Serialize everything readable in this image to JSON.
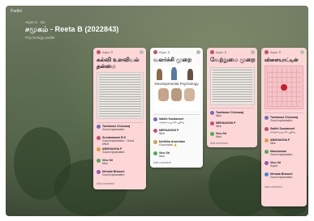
{
  "app": {
    "top_label": "Padlet"
  },
  "header": {
    "crumb": "Arjun S · 2w",
    "title": "சமூகம் - Reeta B (2022843)",
    "subtitle": "Psychology padlet"
  },
  "columns": [
    {
      "author": "Arjun S",
      "title": "கல்வி உளவியல் தன்மை",
      "comments": [
        {
          "name": "Tamilarasi Chinnaraj",
          "text": "Good explanation",
          "color": "#6e6ec8"
        },
        {
          "name": "Sundaramani B D",
          "text": "Good explanation · Good effort",
          "color": "#c8506e"
        },
        {
          "name": "ABISHAGHA P",
          "text": "Good explanation",
          "color": "#d8a23c"
        },
        {
          "name": "Vinu Sri",
          "text": "Nice",
          "color": "#4caf50"
        },
        {
          "name": "Nirmala Bhavani",
          "text": "Good explanation",
          "color": "#8c5ab4"
        }
      ],
      "footer": "Add comment"
    },
    {
      "author": "Arjun S",
      "title": "வளர்ச்சி முறை",
      "image_caption": "Developmental Psychology",
      "comments": [
        {
          "name": "Sakthi Sundaravel",
          "text": "அருமையான பதிவு",
          "color": "#6e6ec8"
        },
        {
          "name": "MEENAKSHI P",
          "text": "Nice",
          "color": "#c8506e"
        },
        {
          "name": "Karthika Aravindan",
          "text": "Good work 👍",
          "color": "#d8a23c"
        },
        {
          "name": "Vinu Sri",
          "text": "Nice",
          "color": "#4caf50"
        }
      ],
      "footer": "Add comment"
    },
    {
      "author": "Arjun S",
      "title": "வேற்றுமை முறை",
      "comments": [
        {
          "name": "Tamilarasi Chinnaraj",
          "text": "Nice",
          "color": "#6e6ec8"
        },
        {
          "name": "MEENAKSHI P",
          "text": "Nice",
          "color": "#c8506e"
        },
        {
          "name": "Vinu Sri",
          "text": "Nice",
          "color": "#4caf50"
        }
      ],
      "footer": "Add comment"
    },
    {
      "author": "Arjun S",
      "title": "விளையாட்டின் முறை",
      "comments": [
        {
          "name": "Tamilarasi Chinnaraj",
          "text": "Good explanation",
          "color": "#6e6ec8"
        },
        {
          "name": "Sakthi Sundaravel",
          "text": "அருமையான பதிவு",
          "color": "#c8506e"
        },
        {
          "name": "ABISHAGHA P",
          "text": "Nice",
          "color": "#d8a23c"
        },
        {
          "name": "Manivannan",
          "text": "Good explanation",
          "color": "#4caf50"
        },
        {
          "name": "Vinu Sri",
          "text": "Super",
          "color": "#8c5ab4"
        },
        {
          "name": "Nirmala Bhavani",
          "text": "Good explanation",
          "color": "#3c8cd8"
        }
      ],
      "footer": "Add comment"
    }
  ]
}
